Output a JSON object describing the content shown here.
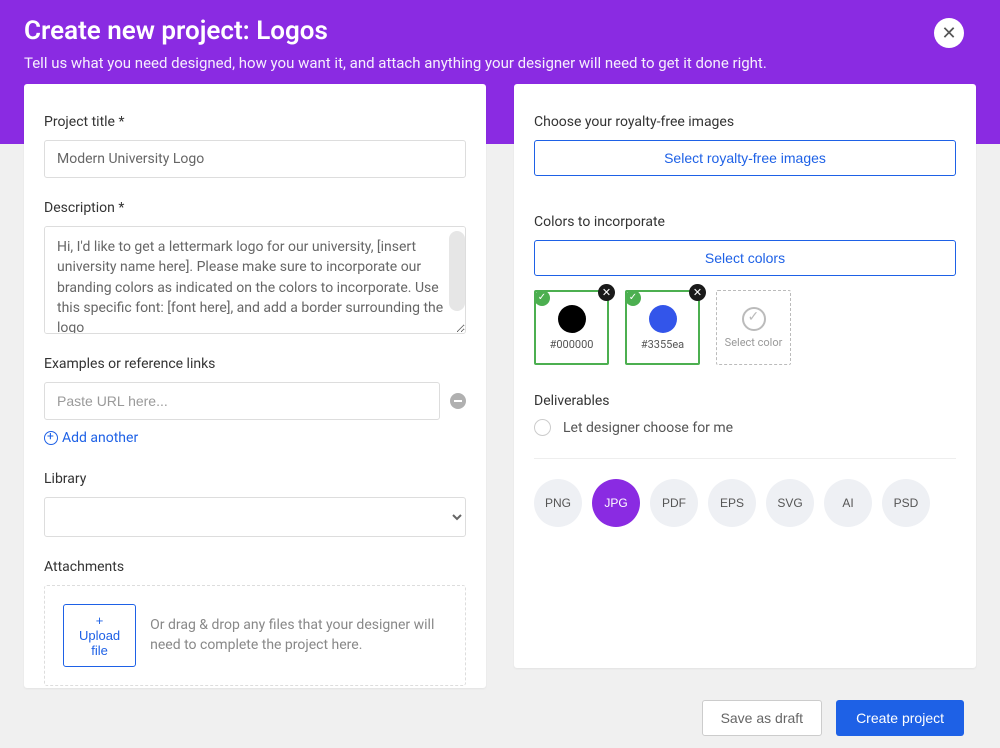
{
  "header": {
    "title": "Create new project: Logos",
    "subtitle": "Tell us what you need designed, how you want it, and attach anything your designer will need to get it done right."
  },
  "left": {
    "project_title_label": "Project title *",
    "project_title_value": "Modern University Logo",
    "description_label": "Description *",
    "description_value": "Hi, I'd like to get a lettermark logo for our university, [insert university name here]. Please make sure to incorporate our branding colors as indicated on the colors to incorporate. Use this specific font: [font here], and add a border surrounding the logo",
    "examples_label": "Examples or reference links",
    "examples_placeholder": "Paste URL here...",
    "add_another_label": "Add another",
    "library_label": "Library",
    "attachments_label": "Attachments",
    "upload_btn": "+ Upload file",
    "attach_text": "Or drag & drop any files that your designer will need to complete the project here."
  },
  "right": {
    "royalty_label": "Choose your royalty-free images",
    "royalty_btn": "Select royalty-free images",
    "colors_label": "Colors to incorporate",
    "colors_btn": "Select colors",
    "swatches": [
      {
        "hex": "#000000",
        "label": "#000000"
      },
      {
        "hex": "#3355ea",
        "label": "#3355ea"
      }
    ],
    "select_color_label": "Select color",
    "deliverables_label": "Deliverables",
    "let_designer_label": "Let designer choose for me",
    "formats": [
      {
        "name": "PNG",
        "active": false
      },
      {
        "name": "JPG",
        "active": true
      },
      {
        "name": "PDF",
        "active": false
      },
      {
        "name": "EPS",
        "active": false
      },
      {
        "name": "SVG",
        "active": false
      },
      {
        "name": "AI",
        "active": false
      },
      {
        "name": "PSD",
        "active": false
      }
    ]
  },
  "footer": {
    "save_draft": "Save as draft",
    "create": "Create project"
  }
}
